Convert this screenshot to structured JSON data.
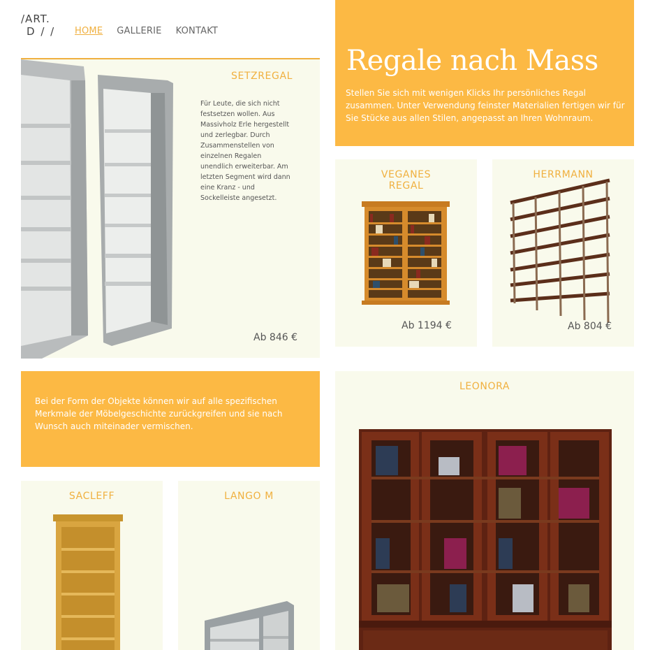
{
  "logo": {
    "line1": "/ART.",
    "line2": "D / /"
  },
  "nav": {
    "home": "HOME",
    "gallery": "GALLERIE",
    "contact": "KONTAKT"
  },
  "hero": {
    "title": "Regale nach Mass",
    "text": "Stellen Sie sich mit wenigen Klicks Ihr persönliches Regal zusammen. Unter Verwendung feinster Materialien fertigen wir für Sie Stücke aus allen Stilen, angepasst an Ihren Wohnraum."
  },
  "setzregal": {
    "title": "SETZREGAL",
    "description": "Für Leute, die sich nicht festsetzen wollen. Aus Massivholz Erle hergestellt und zerlegbar. Durch Zusammenstellen von einzelnen Regalen unendlich erweiterbar. Am letzten Segment wird dann eine Kranz - und Sockelleiste angesetzt.",
    "price": "Ab 846 €"
  },
  "vegan": {
    "title": "VEGANES REGAL",
    "price": "Ab 1194 €"
  },
  "herrmann": {
    "title": "HERRMANN",
    "price": "Ab 804 €"
  },
  "info": {
    "text": "Bei der Form der Objekte können wir auf alle spezifischen Merkmale der Möbelgeschichte zurückgreifen und sie nach Wunsch auch miteinader vermischen."
  },
  "leonora": {
    "title": "LEONORA"
  },
  "sacleff": {
    "title": "SACLEFF"
  },
  "lango": {
    "title": "LANGO M"
  },
  "colors": {
    "accent": "#fcb944",
    "accent_text": "#f0b03f",
    "card_bg": "#f9faec"
  }
}
